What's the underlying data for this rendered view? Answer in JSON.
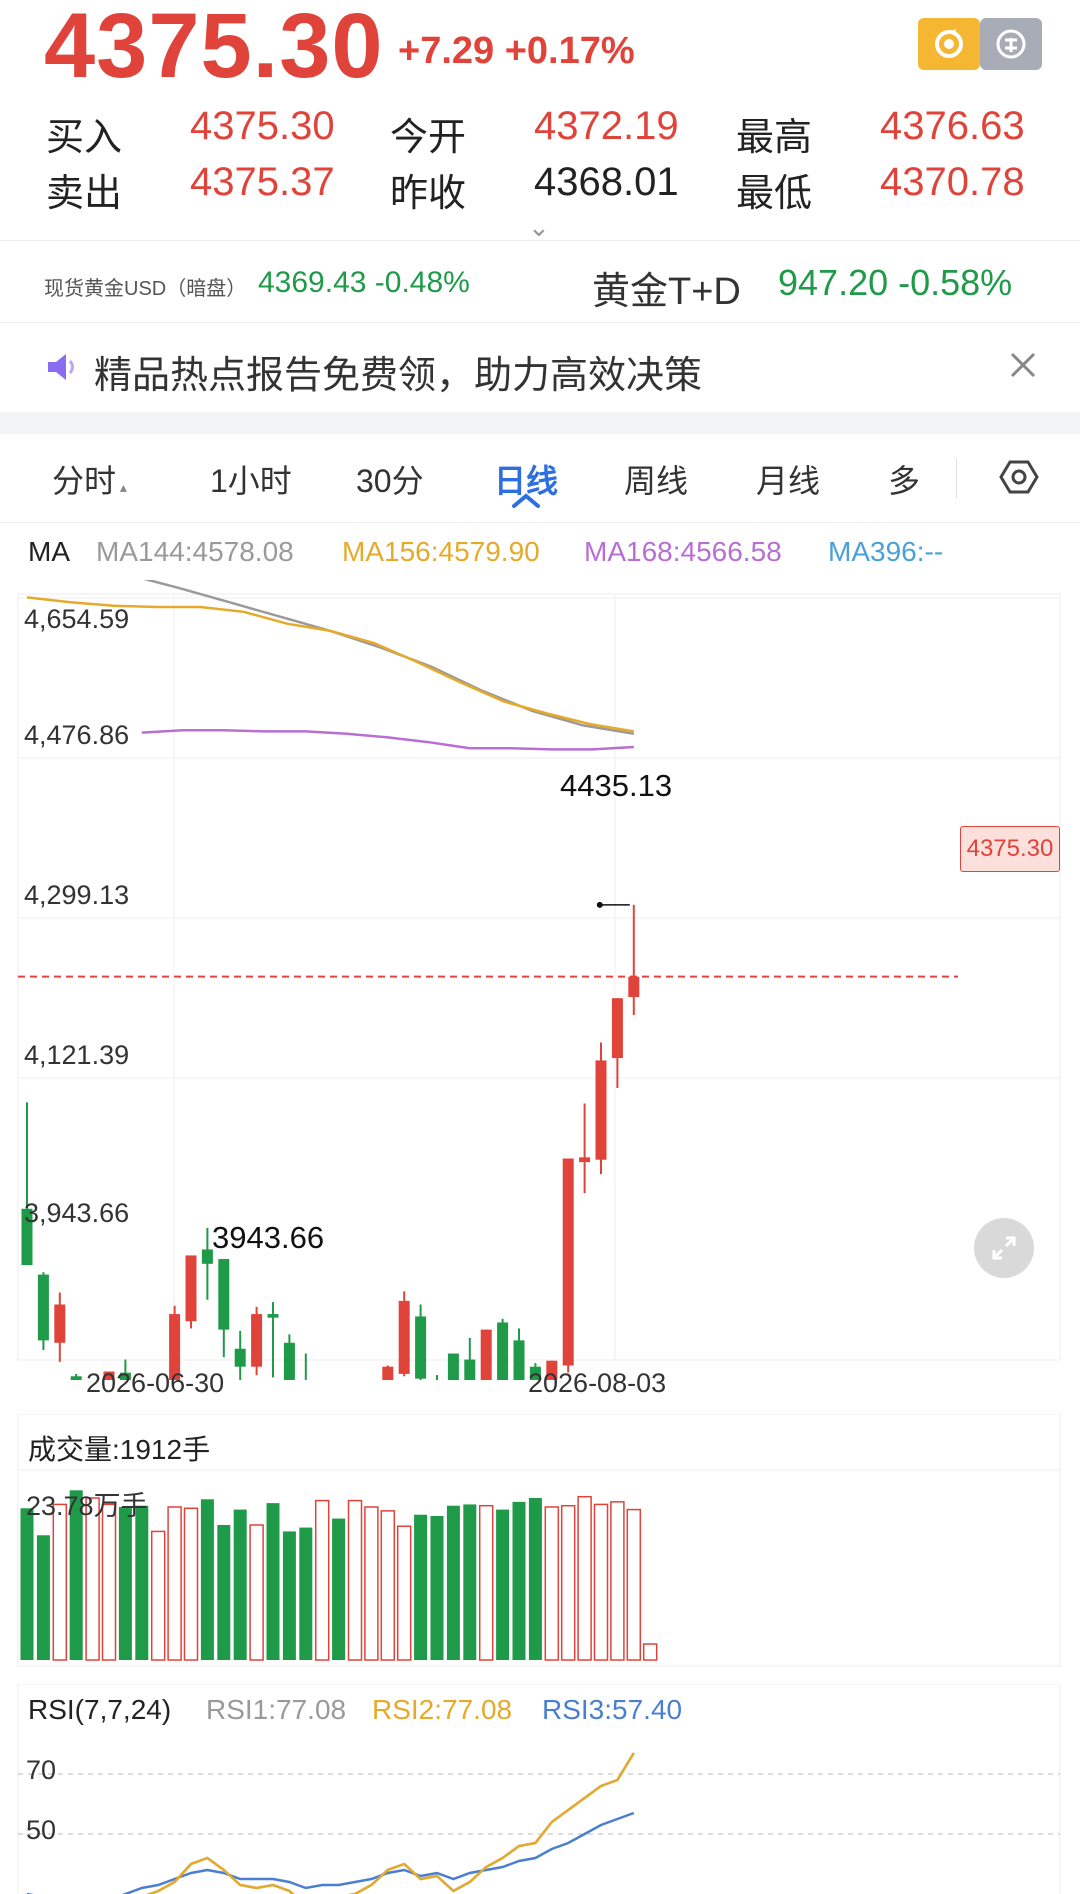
{
  "quote": {
    "price": "4375.30",
    "change": "+7.29 +0.17%",
    "bid_label": "买入",
    "bid": "4375.30",
    "ask_label": "卖出",
    "ask": "4375.37",
    "open_label": "今开",
    "open": "4372.19",
    "prev_close_label": "昨收",
    "prev_close": "4368.01",
    "high_label": "最高",
    "high": "4376.63",
    "low_label": "最低",
    "low": "4370.78"
  },
  "tickers": {
    "spot_label": "现货黄金USD（暗盘）",
    "spot_value": "4369.43 -0.48%",
    "td_label": "黄金T+D",
    "td_value": "947.20 -0.58%"
  },
  "banner": {
    "text": "精品热点报告免费领，助力高效决策"
  },
  "tabs": [
    "分时",
    "1小时",
    "30分",
    "日线",
    "周线",
    "月线",
    "多"
  ],
  "active_tab": "日线",
  "colors": {
    "up": "#e0433a",
    "down": "#1f9a48",
    "accent": "#2d6ee0",
    "ma144": "#9a9a9a",
    "ma156": "#e6aa2a",
    "ma168": "#b86fd4",
    "ma396": "#4aa0d8"
  },
  "ma": {
    "label": "MA",
    "ma144": "MA144:4578.08",
    "ma156": "MA156:4579.90",
    "ma168": "MA168:4566.58",
    "ma396": "MA396:--"
  },
  "price_axis": [
    "4,654.59",
    "4,476.86",
    "4,299.13",
    "4,121.39",
    "3,943.66"
  ],
  "date_axis": [
    "2026-06-30",
    "2026-08-03"
  ],
  "annotations": {
    "max": "4435.13",
    "min": "3943.66",
    "last": "4375.30"
  },
  "volume": {
    "title": "成交量:1912手",
    "axis": "23.78万手"
  },
  "rsi": {
    "title": "RSI(7,7,24)",
    "rsi1": "RSI1:77.08",
    "rsi2": "RSI2:77.08",
    "rsi3": "RSI3:57.40",
    "axis": [
      "70",
      "50"
    ]
  },
  "chart_data": {
    "type": "candlestick",
    "ylim": [
      3854,
      4740
    ],
    "candles": [
      {
        "o": 4181,
        "h": 4270,
        "l": 4161,
        "c": 4134
      },
      {
        "o": 4126,
        "h": 4128,
        "l": 4063,
        "c": 4071
      },
      {
        "o": 4069,
        "h": 4111,
        "l": 4053,
        "c": 4101
      },
      {
        "o": 4041,
        "h": 4043,
        "l": 3940,
        "c": 3933
      },
      {
        "o": 3965,
        "h": 3992,
        "l": 3958,
        "c": 3980
      },
      {
        "o": 3994,
        "h": 4040,
        "l": 3982,
        "c": 4045
      },
      {
        "o": 4044,
        "h": 4055,
        "l": 3971,
        "c": 3980
      },
      {
        "o": 3974,
        "h": 4001,
        "l": 3929,
        "c": 3965
      },
      {
        "o": 3973,
        "h": 4032,
        "l": 3950,
        "c": 3988
      },
      {
        "o": 4002,
        "h": 4100,
        "l": 3985,
        "c": 4093
      },
      {
        "o": 4087,
        "h": 4141,
        "l": 4081,
        "c": 4142
      },
      {
        "o": 4147,
        "h": 4165,
        "l": 4105,
        "c": 4135
      },
      {
        "o": 4139,
        "h": 4121,
        "l": 4057,
        "c": 4080
      },
      {
        "o": 4064,
        "h": 4079,
        "l": 4002,
        "c": 4049
      },
      {
        "o": 4049,
        "h": 4099,
        "l": 4042,
        "c": 4093
      },
      {
        "o": 4093,
        "h": 4103,
        "l": 4040,
        "c": 4090
      },
      {
        "o": 4069,
        "h": 4076,
        "l": 3966,
        "c": 3970
      },
      {
        "o": 4009,
        "h": 4060,
        "l": 3944,
        "c": 3958
      },
      {
        "o": 3998,
        "h": 4026,
        "l": 3983,
        "c": 4003
      },
      {
        "o": 4031,
        "h": 4035,
        "l": 3941,
        "c": 3940
      },
      {
        "o": 3940,
        "h": 3977,
        "l": 3924,
        "c": 3965
      },
      {
        "o": 3967,
        "h": 3993,
        "l": 3960,
        "c": 3974
      },
      {
        "o": 3980,
        "h": 4050,
        "l": 3968,
        "c": 4049
      },
      {
        "o": 4043,
        "h": 4112,
        "l": 4041,
        "c": 4104
      },
      {
        "o": 4091,
        "h": 4101,
        "l": 4022,
        "c": 4039
      },
      {
        "o": 4032,
        "h": 4042,
        "l": 4002,
        "c": 4028
      },
      {
        "o": 4060,
        "h": 4060,
        "l": 4002,
        "c": 4006
      },
      {
        "o": 4055,
        "h": 4073,
        "l": 4006,
        "c": 4005
      },
      {
        "o": 4011,
        "h": 4075,
        "l": 3966,
        "c": 4080
      },
      {
        "o": 4086,
        "h": 4089,
        "l": 3963,
        "c": 4030
      },
      {
        "o": 4071,
        "h": 4081,
        "l": 4005,
        "c": 4031
      },
      {
        "o": 4049,
        "h": 4052,
        "l": 3993,
        "c": 4025
      },
      {
        "o": 4035,
        "h": 4047,
        "l": 4006,
        "c": 4054
      },
      {
        "o": 4050,
        "h": 4078,
        "l": 4044,
        "c": 4223
      },
      {
        "o": 4220,
        "h": 4269,
        "l": 4194,
        "c": 4224
      },
      {
        "o": 4222,
        "h": 4320,
        "l": 4210,
        "c": 4305
      },
      {
        "o": 4307,
        "h": 4357,
        "l": 4282,
        "c": 4357
      },
      {
        "o": 4358,
        "h": 4435,
        "l": 4343,
        "c": 4375
      }
    ],
    "ma_series": [
      {
        "name": "MA144",
        "values": [
          4735,
          4722,
          4711,
          4700,
          4688,
          4676,
          4664,
          4650,
          4634,
          4614,
          4597,
          4585,
          4578
        ]
      },
      {
        "name": "MA156",
        "values": [
          4692,
          4688,
          4685,
          4684,
          4684,
          4680,
          4670,
          4664,
          4654,
          4638,
          4621,
          4605,
          4595,
          4586,
          4580
        ]
      },
      {
        "name": "MA168",
        "values": [
          4579,
          4581,
          4581,
          4580,
          4580,
          4578,
          4575,
          4571,
          4566,
          4566,
          4565,
          4565,
          4567
        ]
      }
    ],
    "volume_values": [
      118,
      97,
      121,
      132,
      126,
      121,
      119,
      120,
      100,
      119,
      118,
      125,
      105,
      117,
      105,
      122,
      100,
      103,
      124,
      110,
      124,
      119,
      116,
      104,
      113,
      112,
      120,
      121,
      120,
      117,
      123,
      126,
      119,
      120,
      127,
      121,
      123,
      117
    ],
    "rsi1": [
      22,
      21,
      20,
      22,
      20,
      20,
      24,
      29,
      31,
      34,
      40,
      42,
      38,
      33,
      32,
      33,
      31,
      26,
      28,
      29,
      30,
      33,
      38,
      40,
      35,
      36,
      31,
      34,
      39,
      42,
      46,
      47,
      54,
      58,
      62,
      66,
      68,
      77
    ],
    "rsi2": [
      22,
      21,
      20,
      22,
      20,
      20,
      24,
      29,
      31,
      34,
      40,
      42,
      38,
      33,
      32,
      33,
      31,
      26,
      28,
      29,
      30,
      33,
      38,
      40,
      35,
      36,
      31,
      34,
      39,
      42,
      46,
      47,
      54,
      58,
      62,
      66,
      68,
      77
    ],
    "rsi3": [
      30,
      29,
      28,
      29,
      28,
      28,
      30,
      32,
      33,
      35,
      37,
      38,
      37,
      35,
      35,
      35,
      34,
      32,
      33,
      33,
      34,
      35,
      37,
      38,
      36,
      37,
      35,
      37,
      38,
      39,
      41,
      42,
      45,
      47,
      50,
      53,
      55,
      57
    ]
  }
}
